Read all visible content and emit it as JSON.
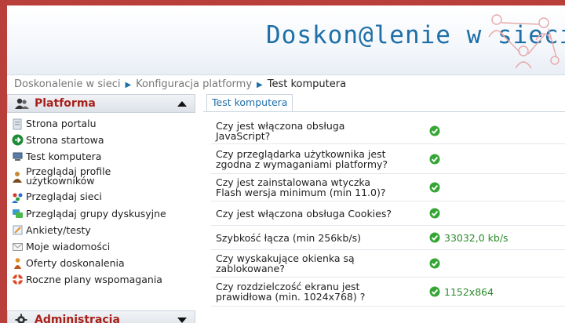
{
  "header": {
    "site_title": "Doskon@lenie w sieci"
  },
  "breadcrumb": {
    "items": [
      "Doskonalenie w sieci",
      "Konfiguracja platformy",
      "Test komputera"
    ]
  },
  "sidebar": {
    "sections": [
      {
        "title": "Platforma",
        "icon": "users-icon",
        "expanded": true,
        "items": [
          {
            "label": "Strona portalu",
            "icon": "portal-page-icon"
          },
          {
            "label": "Strona startowa",
            "icon": "start-arrow-icon"
          },
          {
            "label": "Test komputera",
            "icon": "computer-icon"
          },
          {
            "label": "Przeglądaj profile użytkowników",
            "line1": "Przeglądaj profile",
            "line2": "użytkowników",
            "icon": "user-profiles-icon"
          },
          {
            "label": "Przeglądaj sieci",
            "icon": "network-icon"
          },
          {
            "label": "Przeglądaj grupy dyskusyjne",
            "icon": "discussion-groups-icon"
          },
          {
            "label": "Ankiety/testy",
            "icon": "survey-icon"
          },
          {
            "label": "Moje wiadomości",
            "icon": "mail-icon"
          },
          {
            "label": "Oferty doskonalenia",
            "icon": "offers-icon"
          },
          {
            "label": "Roczne plany wspomagania",
            "icon": "lifebuoy-icon"
          }
        ]
      },
      {
        "title": "Administracja",
        "icon": "gear-icon",
        "expanded": false
      }
    ]
  },
  "content": {
    "tab_label": "Test komputera",
    "checks": [
      {
        "q1": "Czy jest włączona obsługa",
        "q2": "JavaScript?",
        "passed": true,
        "value": ""
      },
      {
        "q1": "Czy przeglądarka użytkownika jest",
        "q2": "zgodna z wymaganiami platformy?",
        "passed": true,
        "value": ""
      },
      {
        "q1": "Czy jest zainstalowana wtyczka",
        "q2": "Flash wersja minimum (min 11.0)?",
        "passed": true,
        "value": ""
      },
      {
        "q1": "Czy jest włączona obsługa Cookies?",
        "q2": "",
        "passed": true,
        "value": ""
      },
      {
        "q1": "Szybkość łącza  (min 256kb/s)",
        "q2": "",
        "passed": true,
        "value": "33032,0 kb/s"
      },
      {
        "q1": "Czy wyskakujące okienka są",
        "q2": "zablokowane?",
        "passed": true,
        "value": ""
      },
      {
        "q1": "Czy rozdzielczość ekranu jest",
        "q2": "prawidłowa (min. 1024x768) ?",
        "passed": true,
        "value": "1152x864"
      }
    ]
  },
  "colors": {
    "accent": "#1e6fa8",
    "section_title": "#a8201a",
    "ok_green": "#35a635",
    "frame": "#b9403a"
  }
}
